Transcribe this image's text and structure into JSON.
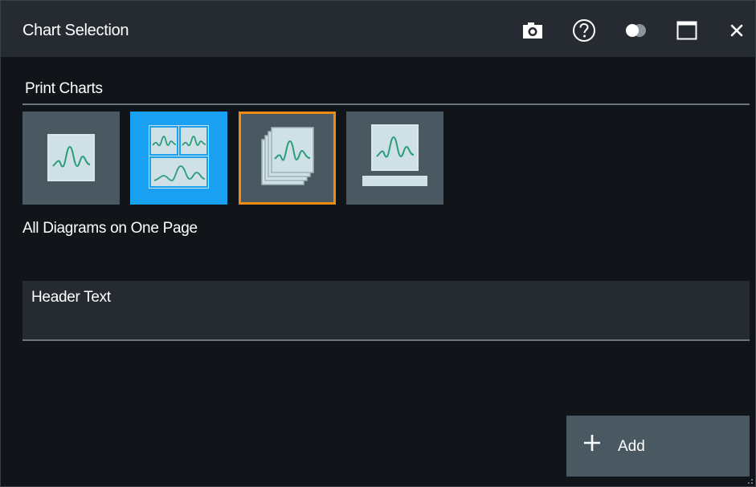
{
  "window": {
    "title": "Chart Selection",
    "icons": [
      "camera-icon",
      "help-icon",
      "toggle-icon",
      "maximize-icon",
      "close-icon"
    ]
  },
  "print_charts": {
    "label": "Print Charts",
    "options": [
      {
        "name": "single-diagram",
        "selected": false,
        "focused": false
      },
      {
        "name": "all-diagrams-on-one-page",
        "selected": true,
        "focused": false
      },
      {
        "name": "diagrams-on-separate-pages",
        "selected": false,
        "focused": true
      },
      {
        "name": "diagram-with-table",
        "selected": false,
        "focused": false
      }
    ],
    "selected_label": "All Diagrams on One Page"
  },
  "header_text": {
    "label": "Header Text",
    "value": ""
  },
  "add_button": {
    "label": "Add",
    "icon": "plus-icon"
  },
  "colors": {
    "accent_blue": "#1aa0f0",
    "focus_orange": "#ef8a12",
    "trace_green": "#2a9d7a",
    "tile_bg": "#4a5862"
  }
}
